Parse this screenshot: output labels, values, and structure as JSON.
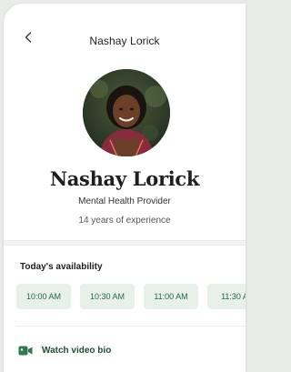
{
  "header": {
    "title": "Nashay Lorick",
    "back_icon": "chevron-left-icon"
  },
  "profile": {
    "name": "Nashay Lorick",
    "role": "Mental Health Provider",
    "experience": "14 years of experience"
  },
  "availability": {
    "title": "Today's availability",
    "slots": [
      "10:00 AM",
      "10:30 AM",
      "11:00 AM",
      "11:30 A"
    ]
  },
  "video": {
    "label": "Watch video bio",
    "icon": "video-camera-icon",
    "accent": "#2f7a4f"
  },
  "colors": {
    "slot_bg": "#e7f1ea",
    "slot_text": "#1f6a42"
  }
}
